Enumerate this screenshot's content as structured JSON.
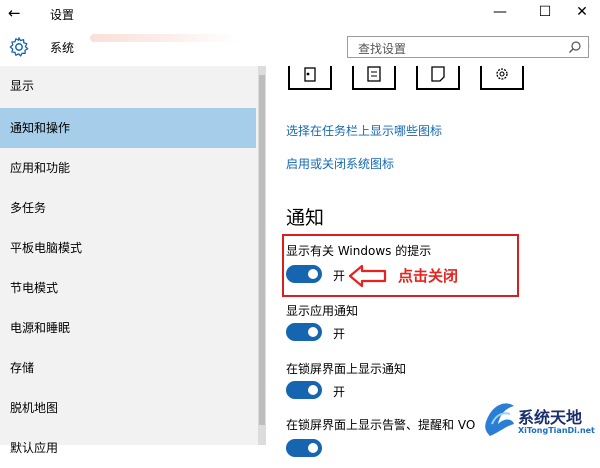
{
  "window": {
    "title": "设置",
    "back_icon": "←",
    "minimize_icon": "—",
    "maximize_icon": "☐",
    "close_icon": "✕"
  },
  "header": {
    "section": "系统",
    "search_placeholder": "查找设置"
  },
  "sidebar": {
    "items": [
      {
        "label": "显示",
        "active": false
      },
      {
        "label": "通知和操作",
        "active": true
      },
      {
        "label": "应用和功能",
        "active": false
      },
      {
        "label": "多任务",
        "active": false
      },
      {
        "label": "平板电脑模式",
        "active": false
      },
      {
        "label": "节电模式",
        "active": false
      },
      {
        "label": "电源和睡眠",
        "active": false
      },
      {
        "label": "存储",
        "active": false
      },
      {
        "label": "脱机地图",
        "active": false
      },
      {
        "label": "默认应用",
        "active": false
      }
    ]
  },
  "main": {
    "links": [
      "选择在任务栏上显示哪些图标",
      "启用或关闭系统图标"
    ],
    "notifications_title": "通知",
    "settings": [
      {
        "label": "显示有关 Windows 的提示",
        "state": "开"
      },
      {
        "label": "显示应用通知",
        "state": "开"
      },
      {
        "label": "在锁屏界面上显示通知",
        "state": "开"
      },
      {
        "label": "在锁屏界面上显示告警、提醒和 VO",
        "state": ""
      }
    ]
  },
  "annotation": {
    "callout": "点击关闭",
    "color": "#e8221d"
  },
  "watermark": {
    "brand": "系统天地",
    "url": "XiTongTianDi.net"
  },
  "colors": {
    "accent": "#1665b0",
    "selected_bg": "#a6cde9",
    "link": "#1469b4"
  }
}
